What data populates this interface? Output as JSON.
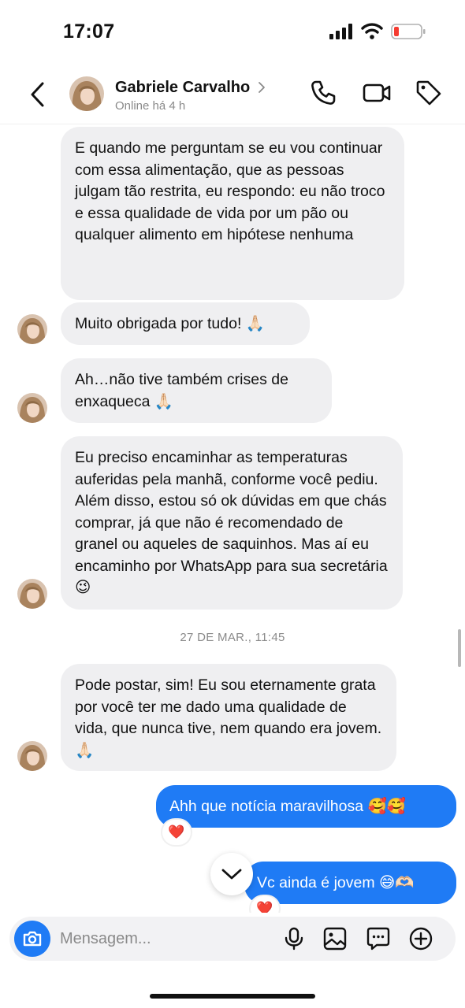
{
  "status_bar": {
    "time": "17:07"
  },
  "header": {
    "contact_name": "Gabriele Carvalho",
    "status": "Online há 4 h",
    "icons": [
      "back-icon",
      "phone-icon",
      "video-icon",
      "tag-icon"
    ]
  },
  "messages": [
    {
      "from": "contact",
      "text": "E quando me perguntam se eu vou continuar com essa alimentação, que as pessoas julgam tão restrita, eu respondo: eu não troco e essa qualidade de vida por um pão ou qualquer alimento em hipótese nenhuma"
    },
    {
      "from": "contact",
      "text": "Muito obrigada por tudo! 🙏🏻"
    },
    {
      "from": "contact",
      "text": "Ah…não tive também crises de enxaqueca 🙏🏻"
    },
    {
      "from": "contact",
      "text": "Eu preciso encaminhar as temperaturas auferidas pela manhã, conforme você pediu. Além disso, estou só ok dúvidas em que chás comprar, já que não é recomendado de granel ou aqueles de saquinhos. Mas aí eu encaminho por WhatsApp para sua secretária 😉"
    },
    {
      "from": "contact",
      "text": "Pode postar, sim! Eu sou eternamente grata por você ter me dado uma qualidade de vida, que nunca tive, nem quando era jovem. 🙏🏻"
    },
    {
      "from": "me",
      "text": "Ahh que notícia maravilhosa 🥰🥰",
      "reaction": "❤️"
    },
    {
      "from": "me",
      "text": "Vc ainda é jovem 😅🫶🏻",
      "reaction": "❤️"
    }
  ],
  "timestamp": "27 DE MAR., 11:45",
  "composer": {
    "placeholder": "Mensagem...",
    "icons": [
      "camera-icon",
      "microphone-icon",
      "gallery-icon",
      "sticker-icon",
      "plus-icon"
    ]
  },
  "colors": {
    "outgoing_bubble": "#1f7bf5",
    "incoming_bubble": "#efeff1",
    "accent": "#1f7bf5"
  }
}
